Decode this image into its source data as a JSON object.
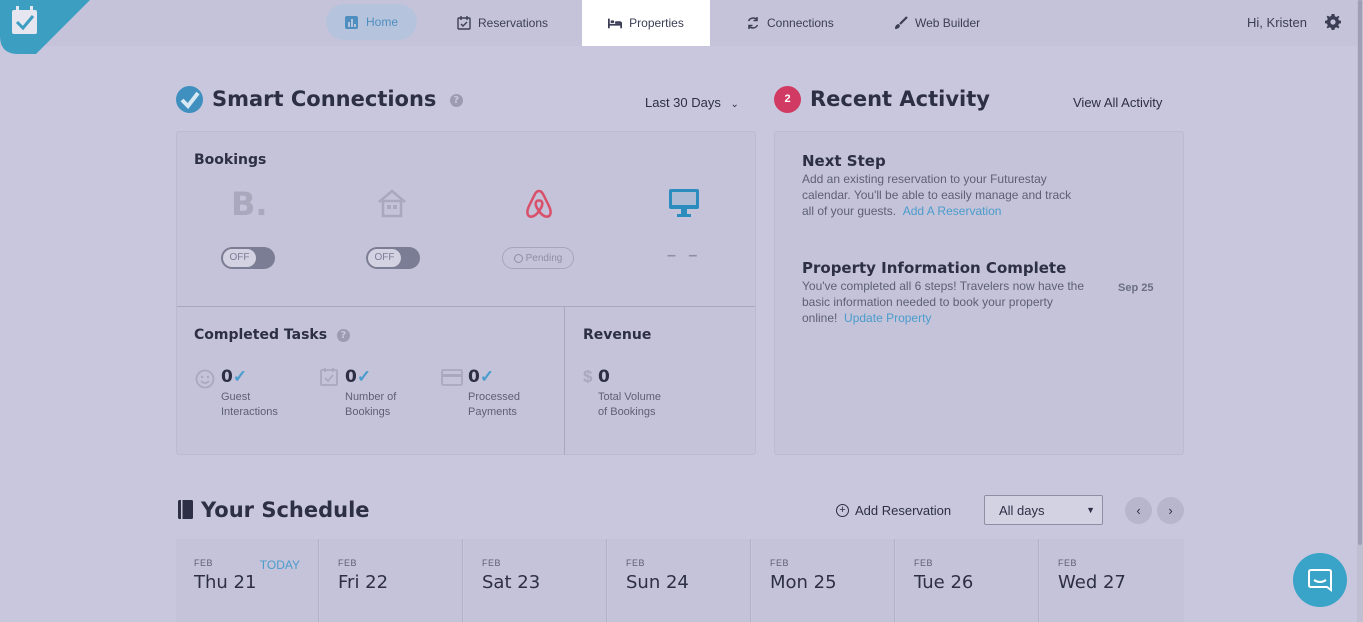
{
  "nav": {
    "items": [
      {
        "label": "Home",
        "icon": "bar-chart-icon"
      },
      {
        "label": "Reservations",
        "icon": "calendar-check-icon"
      },
      {
        "label": "Properties",
        "icon": "bed-icon"
      },
      {
        "label": "Connections",
        "icon": "sync-icon"
      },
      {
        "label": "Web Builder",
        "icon": "brush-icon"
      }
    ],
    "greeting": "Hi, Kristen"
  },
  "smart": {
    "title": "Smart Connections",
    "help": "?",
    "range": "Last 30 Days",
    "bookings_title": "Bookings",
    "booking_logo_text": "B.",
    "toggle_off_1": "OFF",
    "toggle_off_2": "OFF",
    "pending": "Pending",
    "dash": "– –",
    "tasks_title": "Completed Tasks",
    "tasks": [
      {
        "value": "0",
        "label1": "Guest",
        "label2": "Interactions"
      },
      {
        "value": "0",
        "label1": "Number of",
        "label2": "Bookings"
      },
      {
        "value": "0",
        "label1": "Processed",
        "label2": "Payments"
      }
    ],
    "revenue_title": "Revenue",
    "revenue_symbol": "$",
    "revenue_value": "0",
    "revenue_label1": "Total Volume",
    "revenue_label2": "of Bookings"
  },
  "activity": {
    "badge": "2",
    "title": "Recent Activity",
    "view_all": "View All Activity",
    "items": [
      {
        "title": "Next Step",
        "line1": "Add an existing reservation to your Futurestay",
        "line2": "calendar. You'll be able to easily manage and track",
        "line3": "all of your guests.",
        "link": "Add A Reservation",
        "date": ""
      },
      {
        "title": "Property Information Complete",
        "line1": "You've completed all 6 steps! Travelers now have the",
        "line2": "basic information needed to book your property",
        "line3": "online!",
        "link": "Update Property",
        "date": "Sep 25"
      }
    ]
  },
  "schedule": {
    "title": "Your Schedule",
    "add": "Add Reservation",
    "filter": "All days",
    "prev": "‹",
    "next": "›",
    "today_label": "TODAY",
    "days": [
      {
        "month": "FEB",
        "name": "Thu 21"
      },
      {
        "month": "FEB",
        "name": "Fri 22"
      },
      {
        "month": "FEB",
        "name": "Sat 23"
      },
      {
        "month": "FEB",
        "name": "Sun 24"
      },
      {
        "month": "FEB",
        "name": "Mon 25"
      },
      {
        "month": "FEB",
        "name": "Tue 26"
      },
      {
        "month": "FEB",
        "name": "Wed 27"
      }
    ]
  },
  "colors": {
    "accent": "#4a9ccc",
    "badge": "#d03a63",
    "airbnb": "#d9506a",
    "background": "#c9c7dd"
  }
}
